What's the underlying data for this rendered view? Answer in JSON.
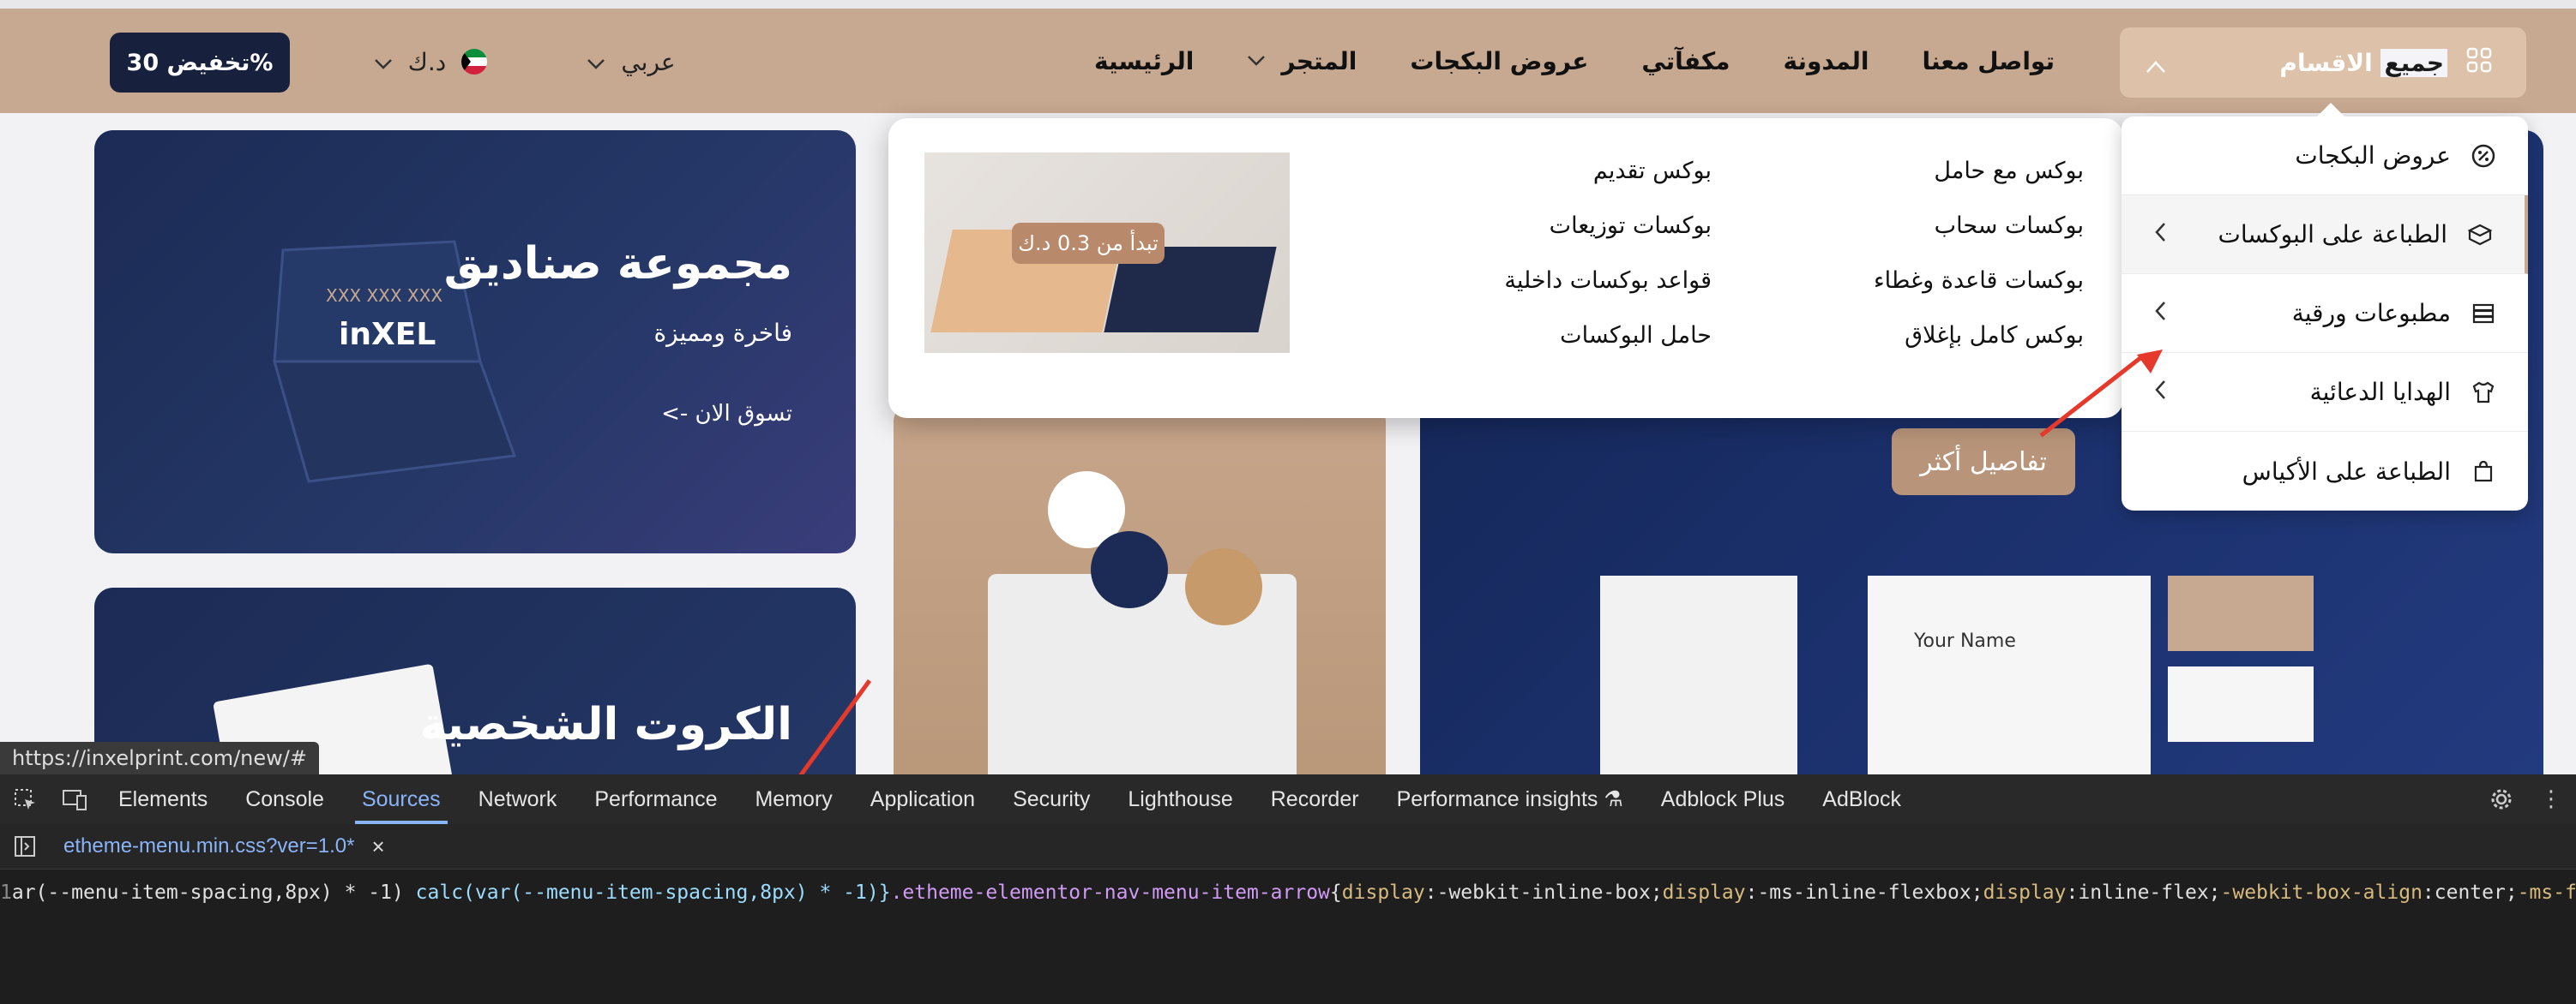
{
  "header": {
    "discount_label": "تخفيض 30%",
    "currency_label": "د.ك",
    "language_label": "عربي",
    "all_categories_label_plain": "الاقسام",
    "all_categories_label_selected": "جميع",
    "nav": [
      {
        "label": "الرئيسية"
      },
      {
        "label": "المتجر"
      },
      {
        "label": "عروض البكجات"
      },
      {
        "label": "مكفآتي"
      },
      {
        "label": "المدونة"
      },
      {
        "label": "تواصل معنا"
      }
    ]
  },
  "banners": {
    "boxes": {
      "title": "مجموعة صناديق",
      "subtitle": "فاخرة ومميزة",
      "cta": "تسوق الان ->",
      "logo": "inXEL",
      "box_code": "XXX XXX XXX"
    },
    "cards": {
      "title": "الكروت الشخصية"
    },
    "details_button": "تفاصيل أكثر",
    "stationery_name": "Your Name"
  },
  "mega_menu": {
    "col_right": [
      "بوكس مع حامل",
      "بوكسات سحاب",
      "بوكسات قاعدة وغطاء",
      "بوكس كامل بإغلاق"
    ],
    "col_left": [
      "بوكس تقديم",
      "بوكسات توزيعات",
      "قواعد بوكسات داخلية",
      "حامل البوكسات"
    ],
    "price_tag": "تبدأ من 0.3 د.ك"
  },
  "category_menu": [
    {
      "label": "عروض البكجات",
      "icon": "badge-percent-icon",
      "has_arrow": false
    },
    {
      "label": "الطباعة على البوكسات",
      "icon": "box-icon",
      "has_arrow": true
    },
    {
      "label": "مطبوعات ورقية",
      "icon": "paper-stack-icon",
      "has_arrow": true
    },
    {
      "label": "الهدايا الدعائية",
      "icon": "tshirt-icon",
      "has_arrow": true
    },
    {
      "label": "الطباعة على الأكياس",
      "icon": "bag-icon",
      "has_arrow": false
    }
  ],
  "status_url": "https://inxelprint.com/new/#",
  "devtools": {
    "tabs": [
      "Elements",
      "Console",
      "Sources",
      "Network",
      "Performance",
      "Memory",
      "Application",
      "Security",
      "Lighthouse",
      "Recorder",
      "Performance insights",
      "Adblock Plus",
      "AdBlock"
    ],
    "active_tab": "Sources",
    "file_tab": "etheme-menu.min.css?ver=1.0*",
    "line_number": "1",
    "code": {
      "part1": "ar(--menu-item-spacing,8px) * -1) ",
      "part2": "calc(var(--menu-item-spacing,8px) * -1)}",
      "part3": ".etheme-elementor-nav-menu-item-arrow",
      "part4": "{",
      "part5": "display",
      "part6": ":-webkit-inline-box;",
      "part7": "display",
      "part8": ":-ms-inline-flexbox;",
      "part9": "display",
      "part10": ":inline-flex;",
      "part11": "-webkit-box-align",
      "part12": ":center;",
      "part13": "-ms-flex"
    }
  },
  "colors": {
    "header_bg": "#c7a890",
    "accent": "#ddc1a8",
    "navy": "#17213d",
    "annotation_arrow": "#e5392b",
    "devtools_accent": "#8ab4f8"
  }
}
